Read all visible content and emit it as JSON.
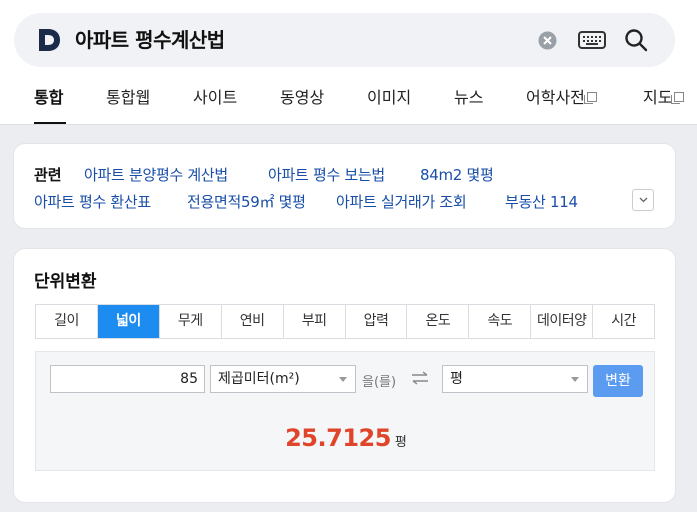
{
  "search": {
    "query": "아파트 평수계산법"
  },
  "nav": {
    "tabs": [
      {
        "label": "통합"
      },
      {
        "label": "통합웹"
      },
      {
        "label": "사이트"
      },
      {
        "label": "동영상"
      },
      {
        "label": "이미지"
      },
      {
        "label": "뉴스"
      },
      {
        "label": "어학사전"
      },
      {
        "label": "지도"
      }
    ]
  },
  "related": {
    "title": "관련",
    "links": [
      "아파트 분양평수 계산법",
      "아파트 평수 보는법",
      "84m2 몇평",
      "아파트 평수 환산표",
      "전용면적59㎡ 몇평",
      "아파트 실거래가 조회",
      "부동산 114"
    ]
  },
  "unit_converter": {
    "title": "단위변환",
    "tabs": [
      "길이",
      "넓이",
      "무게",
      "연비",
      "부피",
      "압력",
      "온도",
      "속도",
      "데이터양",
      "시간"
    ],
    "active_tab": "넓이",
    "input_value": "85",
    "from_unit": "제곱미터(m²)",
    "particle": "을(를)",
    "to_unit": "평",
    "convert_label": "변환",
    "result_value": "25.7125",
    "result_unit": "평"
  },
  "colors": {
    "accent": "#1c8cf0",
    "result": "#e0452b",
    "link": "#1a4fa8",
    "button": "#5b9cf0"
  }
}
